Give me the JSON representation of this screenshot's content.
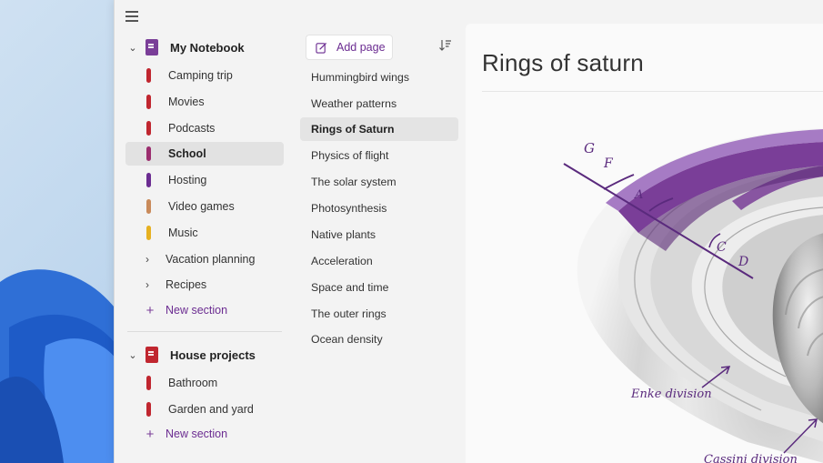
{
  "notebooks": [
    {
      "title": "My Notebook",
      "color": "#7a3e98",
      "sections": [
        {
          "label": "Camping trip",
          "color": "#c0262f"
        },
        {
          "label": "Movies",
          "color": "#c0262f"
        },
        {
          "label": "Podcasts",
          "color": "#c0262f"
        },
        {
          "label": "School",
          "color": "#9b2d6e"
        },
        {
          "label": "Hosting",
          "color": "#6b2c91"
        },
        {
          "label": "Video games",
          "color": "#c98a5a"
        },
        {
          "label": "Music",
          "color": "#e6b020"
        },
        {
          "label": "Vacation planning"
        },
        {
          "label": "Recipes"
        }
      ],
      "new_section": "New section"
    },
    {
      "title": "House projects",
      "color": "#c0262f",
      "sections": [
        {
          "label": "Bathroom",
          "color": "#c0262f"
        },
        {
          "label": "Garden and yard",
          "color": "#c0262f"
        }
      ],
      "new_section": "New section"
    }
  ],
  "pages_pane": {
    "add_page": "Add page",
    "pages": [
      "Hummingbird wings",
      "Weather patterns",
      "Rings of Saturn",
      "Physics of flight",
      "The solar system",
      "Photosynthesis",
      "Native plants",
      "Acceleration",
      "Space and time",
      "The outer rings",
      "Ocean density"
    ],
    "selected_page": "Rings of Saturn"
  },
  "canvas": {
    "title": "Rings of saturn",
    "labels": {
      "g": "G",
      "f": "F",
      "a": "A",
      "c": "C",
      "d": "D",
      "encke": "Enke division",
      "cassini": "Cassini division"
    }
  },
  "icons": [
    "hamburger-icon",
    "chevron-down-icon",
    "notebook-icon",
    "chevron-right-icon",
    "plus-icon",
    "add-page-icon",
    "sort-icon"
  ],
  "colors": {
    "accent": "#6b2c91",
    "ring_purple": "#7a3e98",
    "ring_light": "#a67bc4"
  }
}
